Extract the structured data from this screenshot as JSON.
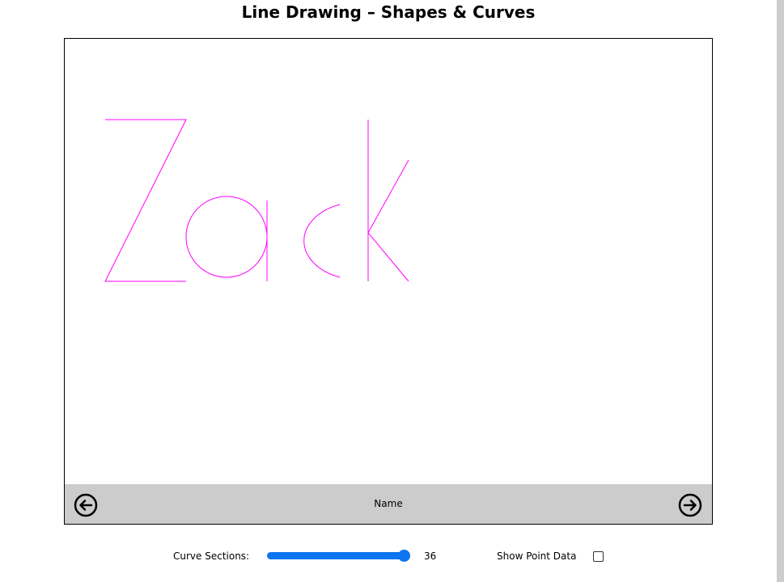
{
  "page": {
    "title": "Line Drawing – Shapes & Curves"
  },
  "canvas": {
    "drawn_text": "Zack",
    "stroke_color": "#ff00ff",
    "nav": {
      "label": "Name",
      "prev_icon": "arrow-left-circle-icon",
      "next_icon": "arrow-right-circle-icon"
    }
  },
  "controls": {
    "curve_sections_label": "Curve Sections:",
    "curve_sections_value": "36",
    "curve_sections_fraction": 1.0,
    "show_point_data_label": "Show Point Data",
    "show_point_data_checked": false,
    "accent_color": "#0d74f2"
  }
}
